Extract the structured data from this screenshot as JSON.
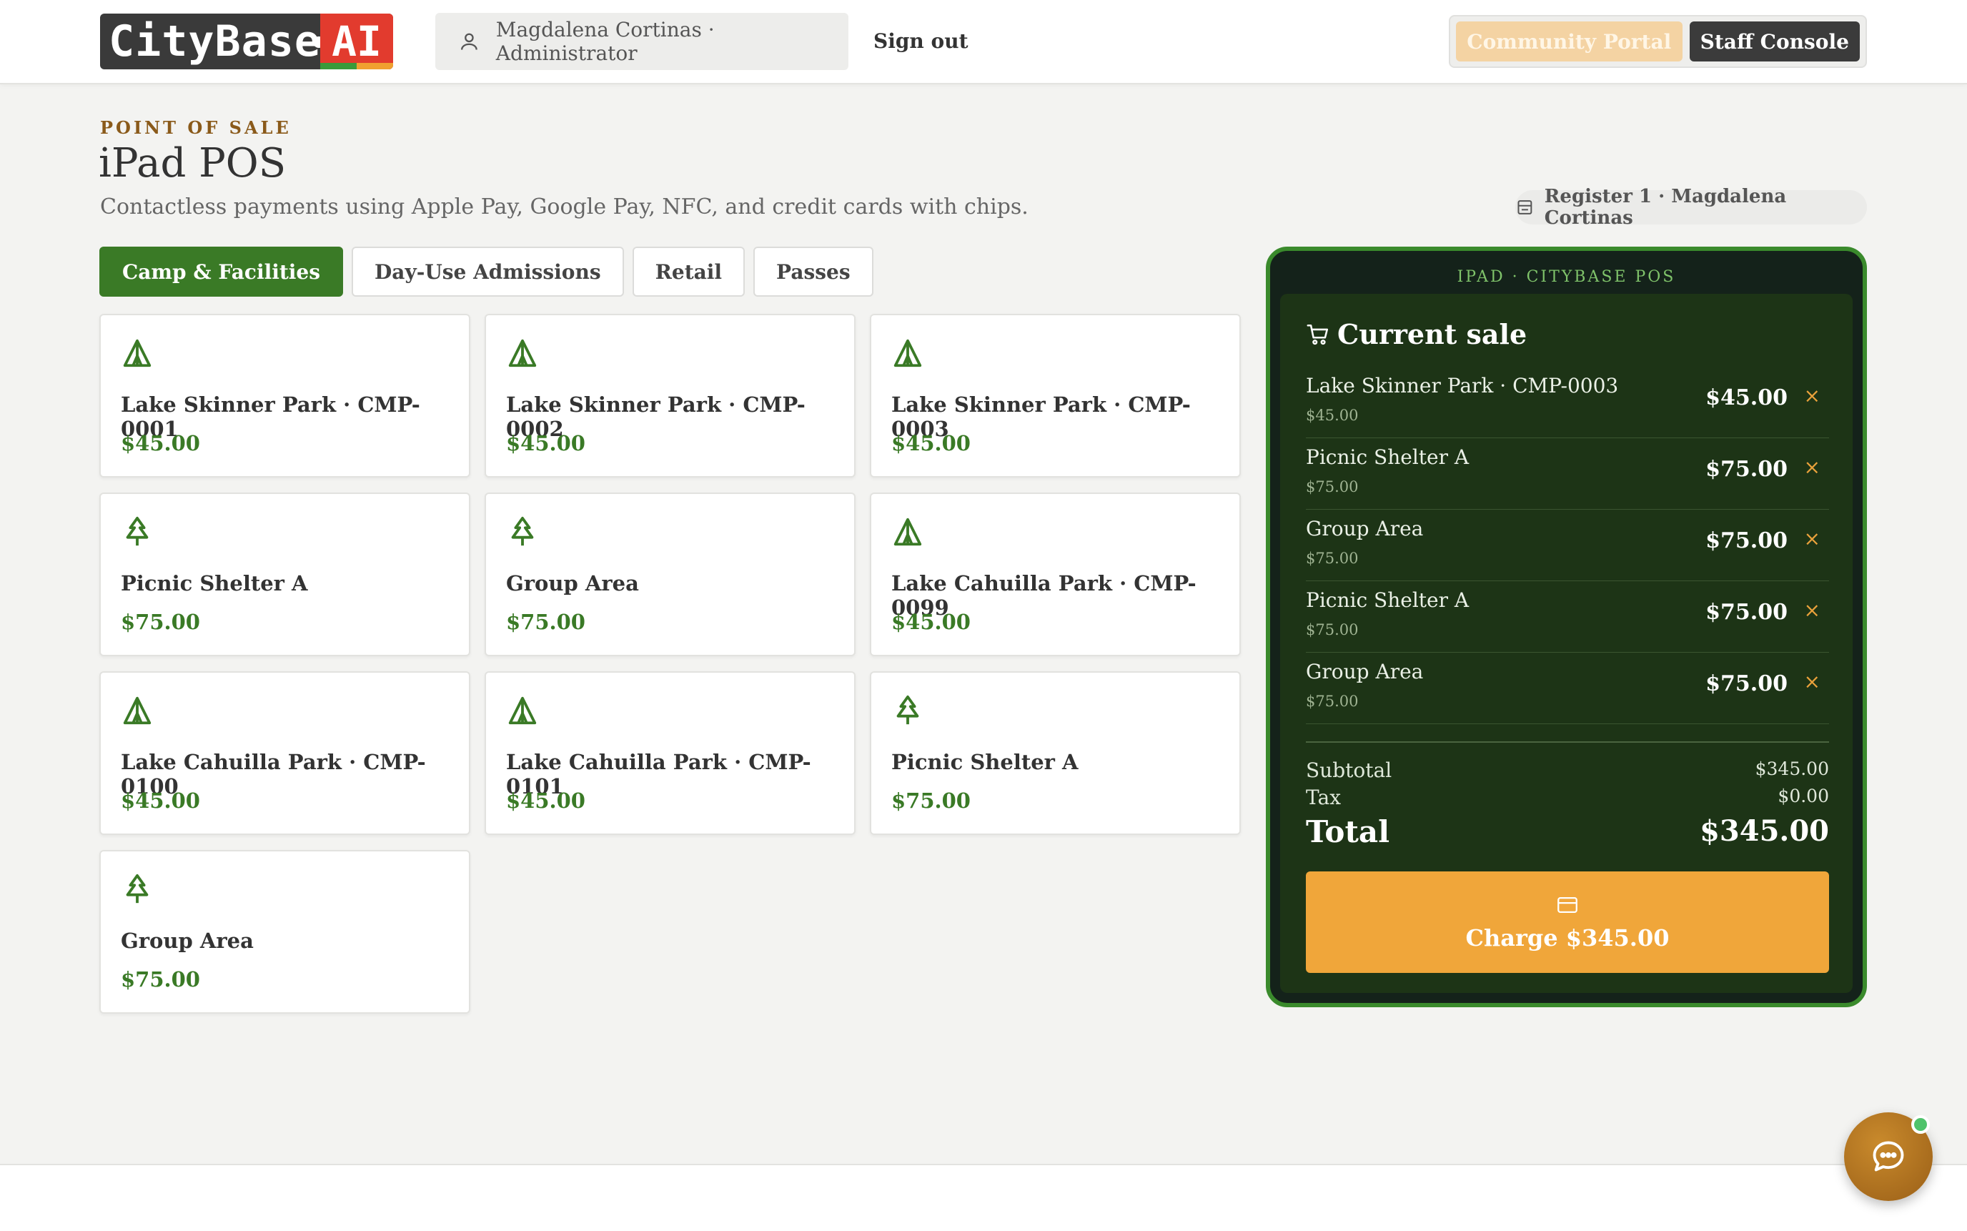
{
  "header": {
    "logo_text": "CityBase",
    "logo_ai": "AI",
    "user": "Magdalena Cortinas · Administrator",
    "signout": "Sign out",
    "portal_community": "Community Portal",
    "portal_staff": "Staff Console"
  },
  "page": {
    "eyebrow": "POINT OF SALE",
    "title": "iPad POS",
    "subtitle": "Contactless payments using Apple Pay, Google Pay, NFC, and credit cards with chips.",
    "register": "Register 1 · Magdalena Cortinas"
  },
  "tabs": [
    {
      "label": "Camp & Facilities",
      "active": true
    },
    {
      "label": "Day-Use Admissions",
      "active": false
    },
    {
      "label": "Retail",
      "active": false
    },
    {
      "label": "Passes",
      "active": false
    }
  ],
  "products": [
    {
      "name": "Lake Skinner Park · CMP-0001",
      "price": "$45.00",
      "icon": "tent-icon"
    },
    {
      "name": "Lake Skinner Park · CMP-0002",
      "price": "$45.00",
      "icon": "tent-icon"
    },
    {
      "name": "Lake Skinner Park · CMP-0003",
      "price": "$45.00",
      "icon": "tent-icon"
    },
    {
      "name": "Picnic Shelter A",
      "price": "$75.00",
      "icon": "tree-icon"
    },
    {
      "name": "Group Area",
      "price": "$75.00",
      "icon": "tree-icon"
    },
    {
      "name": "Lake Cahuilla Park · CMP-0099",
      "price": "$45.00",
      "icon": "tent-icon"
    },
    {
      "name": "Lake Cahuilla Park · CMP-0100",
      "price": "$45.00",
      "icon": "tent-icon"
    },
    {
      "name": "Lake Cahuilla Park · CMP-0101",
      "price": "$45.00",
      "icon": "tent-icon"
    },
    {
      "name": "Picnic Shelter A",
      "price": "$75.00",
      "icon": "tree-icon"
    },
    {
      "name": "Group Area",
      "price": "$75.00",
      "icon": "tree-icon"
    }
  ],
  "sale": {
    "device_label": "IPAD · CITYBASE POS",
    "title": "Current sale",
    "lines": [
      {
        "name": "Lake Skinner Park · CMP-0003",
        "unit": "$45.00",
        "amount": "$45.00"
      },
      {
        "name": "Picnic Shelter A",
        "unit": "$75.00",
        "amount": "$75.00"
      },
      {
        "name": "Group Area",
        "unit": "$75.00",
        "amount": "$75.00"
      },
      {
        "name": "Picnic Shelter A",
        "unit": "$75.00",
        "amount": "$75.00"
      },
      {
        "name": "Group Area",
        "unit": "$75.00",
        "amount": "$75.00"
      }
    ],
    "remove_glyph": "×",
    "subtotal_label": "Subtotal",
    "subtotal": "$345.00",
    "tax_label": "Tax",
    "tax": "$0.00",
    "total_label": "Total",
    "total": "$345.00",
    "charge_label": "Charge $345.00"
  },
  "colors": {
    "accent_green": "#3a7a26",
    "charge_orange": "#f0a63a",
    "panel_dark": "#1d3416"
  }
}
